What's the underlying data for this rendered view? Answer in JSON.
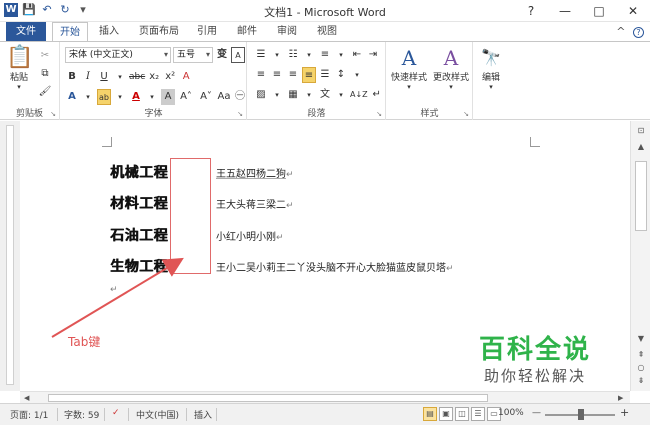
{
  "window": {
    "title": "文档1 - Microsoft Word",
    "app_icon": "W",
    "controls": [
      "?",
      "—",
      "□",
      "✕"
    ]
  },
  "qat": {
    "save_icon": "💾",
    "undo_icon": "↶",
    "redo_icon": "↻",
    "more_icon": "▾"
  },
  "tabs": [
    {
      "label": "文件"
    },
    {
      "label": "开始"
    },
    {
      "label": "插入"
    },
    {
      "label": "页面布局"
    },
    {
      "label": "引用"
    },
    {
      "label": "邮件"
    },
    {
      "label": "审阅"
    },
    {
      "label": "视图"
    }
  ],
  "tab_right": {
    "smile": "☺",
    "collapse": "^"
  },
  "ribbon": {
    "clipboard": {
      "paste_label": "粘贴",
      "group_label": "剪贴板",
      "cut": "✂",
      "copy": "⧉",
      "format_painter": "🖌"
    },
    "font": {
      "font_name": "宋体 (中文正文)",
      "font_size": "五号",
      "wen_button": "变",
      "bold": "B",
      "italic": "I",
      "underline": "U",
      "strike": "abc",
      "subscript": "x₂",
      "superscript": "x²",
      "clear": "A",
      "text_effect": "A",
      "highlight": "ab",
      "font_color": "A",
      "char_shading": "A",
      "grow": "A˄",
      "shrink": "A˅",
      "change_case": "Aa",
      "enclose": "㊀",
      "group_label": "字体"
    },
    "paragraph": {
      "group_label": "段落",
      "bullets": "☰",
      "numbering": "☷",
      "multilevel": "≡",
      "decrease": "⇤",
      "increase": "⇥",
      "align_left": "≡",
      "align_center": "≡",
      "align_right": "≡",
      "justify": "≡",
      "distribute": "☰",
      "line_spacing": "↕",
      "shading": "▨",
      "borders": "▦",
      "chinese_layout": "文",
      "sort": "A↓Z",
      "show_marks": "↵"
    },
    "styles": {
      "group_label": "样式",
      "quick": "快速样式",
      "change": "更改样式"
    },
    "editing": {
      "label": "编辑"
    }
  },
  "document": {
    "lines": [
      {
        "label": "机械工程",
        "name": "王五赵四杨二狗"
      },
      {
        "label": "材料工程",
        "name": "王大头蒋三梁二"
      },
      {
        "label": "石油工程",
        "name": "小红小明小刚"
      },
      {
        "label": "生物工程",
        "name": "王小二吴小莉王二丫没头脑不开心大脸猫蓝皮鼠贝塔"
      }
    ],
    "para_mark": "↵",
    "annotation": "Tab键"
  },
  "watermark": {
    "line1": "百科全说",
    "line2": "助你轻松解决"
  },
  "status": {
    "page": "页面: 1/1",
    "words": "字数: 59",
    "language": "中文(中国)",
    "insert_mode": "插入",
    "zoom": "100%",
    "zoom_minus": "—",
    "zoom_plus": "+"
  },
  "colors": {
    "word_blue": "#2b579a",
    "annotation_red": "#e05555",
    "watermark_green": "#2fb34a"
  }
}
